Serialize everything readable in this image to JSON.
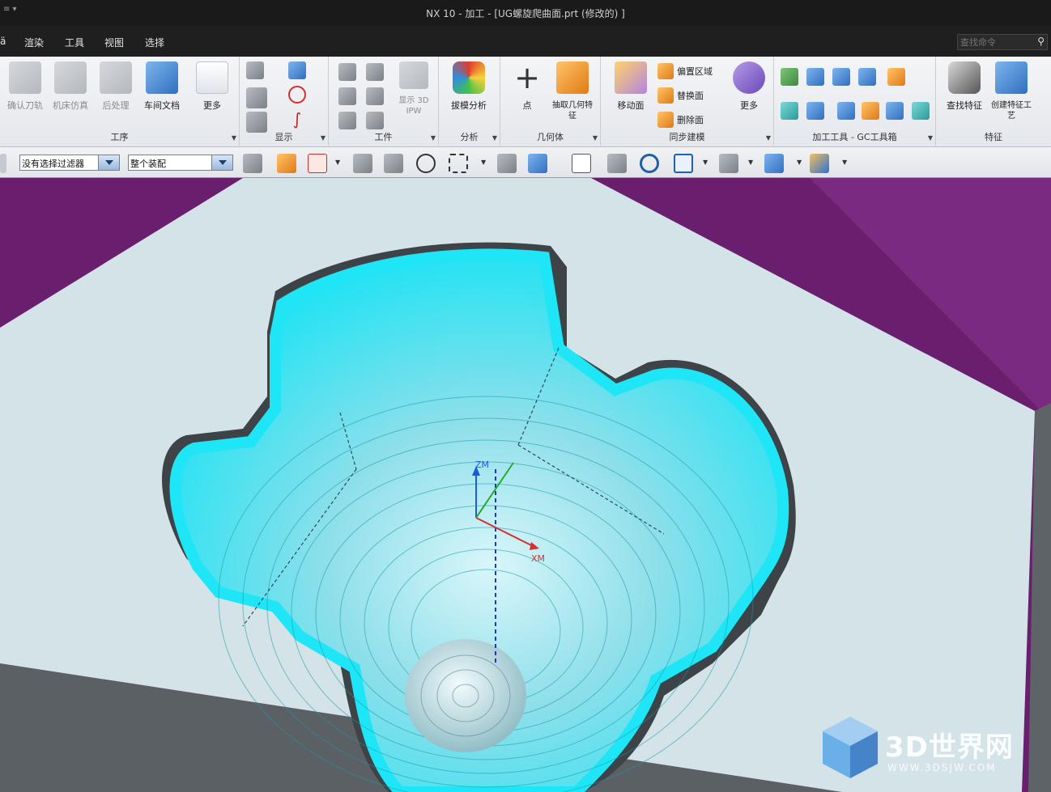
{
  "window": {
    "title": "NX 10 - 加工 - [UG螺旋爬曲面.prt (修改的) ]",
    "left_marker": "≡ ▾"
  },
  "menu": {
    "items": [
      "渲染",
      "工具",
      "视图",
      "选择"
    ],
    "left_edge": "ä"
  },
  "search": {
    "placeholder": "查找命令"
  },
  "ribbon": {
    "groups": {
      "process": {
        "label": "工序",
        "buttons": [
          "确认刀轨",
          "机床仿真",
          "后处理",
          "车间文档",
          "更多"
        ]
      },
      "display": {
        "label": "显示"
      },
      "workpiece": {
        "label": "工件",
        "buttons": [
          "显示 3D IPW"
        ]
      },
      "analysis": {
        "label": "分析",
        "buttons": [
          "拔模分析"
        ]
      },
      "geometry": {
        "label": "几何体",
        "buttons": [
          "点",
          "抽取几何特征"
        ]
      },
      "sync": {
        "label": "同步建模",
        "buttons": [
          "移动面",
          "偏置区域",
          "替换面",
          "删除面",
          "更多"
        ]
      },
      "tools": {
        "label": "加工工具 - GC工具箱"
      },
      "feature": {
        "label": "特征",
        "buttons": [
          "查找特征",
          "创建特征工艺"
        ]
      }
    }
  },
  "selection_toolbar": {
    "filter_value": "没有选择过滤器",
    "scope_value": "整个装配"
  },
  "viewport": {
    "axis_z": "ZM",
    "axis_x": "XM",
    "colors": {
      "background": "#6a1f6e",
      "part": "#d5e5ea",
      "toolpath": "#24e6f5",
      "side": "#666b70"
    }
  },
  "watermark": {
    "brand": "3D世界网",
    "url": "WWW.3DSJW.COM"
  }
}
